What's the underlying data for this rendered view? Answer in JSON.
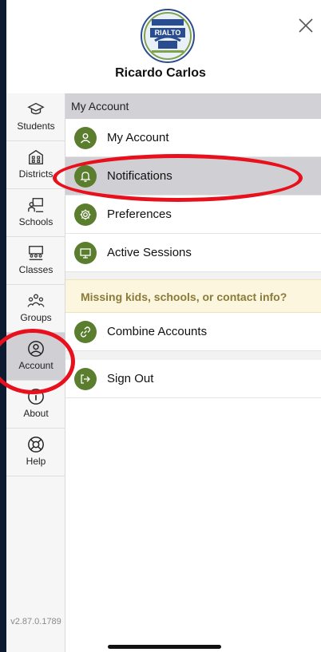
{
  "header": {
    "logo_text": "RIALTO",
    "user_name": "Ricardo Carlos"
  },
  "rail": {
    "items": [
      {
        "label": "Students",
        "icon": "graduation-cap-icon"
      },
      {
        "label": "Districts",
        "icon": "building-icon"
      },
      {
        "label": "Schools",
        "icon": "school-board-icon"
      },
      {
        "label": "Classes",
        "icon": "classroom-icon"
      },
      {
        "label": "Groups",
        "icon": "group-icon"
      },
      {
        "label": "Account",
        "icon": "user-circle-icon",
        "active": true
      },
      {
        "label": "About",
        "icon": "info-icon"
      },
      {
        "label": "Help",
        "icon": "lifebuoy-icon"
      }
    ],
    "version": "v2.87.0.1789"
  },
  "main": {
    "section_title": "My Account",
    "rows": [
      {
        "label": "My Account",
        "icon": "user-icon"
      },
      {
        "label": "Notifications",
        "icon": "bell-icon",
        "selected": true
      },
      {
        "label": "Preferences",
        "icon": "gear-icon"
      },
      {
        "label": "Active Sessions",
        "icon": "monitor-icon"
      }
    ],
    "banner": "Missing kids, schools, or contact info?",
    "combine": {
      "label": "Combine Accounts",
      "icon": "link-icon"
    },
    "signout": {
      "label": "Sign Out",
      "icon": "sign-out-icon"
    }
  },
  "colors": {
    "icon_green": "#5a7d2e",
    "annotation_red": "#e8101c",
    "background_navy": "#0d1b30"
  }
}
